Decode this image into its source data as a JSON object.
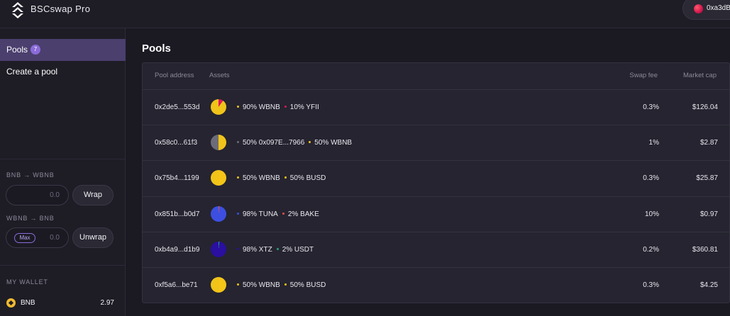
{
  "header": {
    "brand": "BSCswap Pro",
    "account": "0xa3dB",
    "account_color": "#e0194f"
  },
  "sidebar": {
    "nav": [
      {
        "label": "Pools",
        "badge": "7",
        "active": true
      },
      {
        "label": "Create a pool",
        "active": false
      }
    ],
    "wrap": {
      "section_label": "BNB → WBNB",
      "input_value": "0.0",
      "button_label": "Wrap"
    },
    "unwrap": {
      "section_label": "WBNB → BNB",
      "max_label": "Max",
      "input_value": "0.0",
      "button_label": "Unwrap"
    },
    "wallet": {
      "section_label": "MY WALLET",
      "items": [
        {
          "symbol": "BNB",
          "balance": "2.97",
          "icon": "bnb-token-icon",
          "color": "#f3ba2f"
        }
      ]
    }
  },
  "main": {
    "title": "Pools",
    "columns": {
      "address": "Pool address",
      "assets": "Assets",
      "fee": "Swap fee",
      "cap": "Market cap"
    },
    "pools": [
      {
        "address": "0x2de5...553d",
        "assets": [
          {
            "label": "90% WBNB",
            "percent": 90,
            "color": "#f0c419"
          },
          {
            "label": "10% YFII",
            "percent": 10,
            "color": "#e0195a"
          }
        ],
        "fee": "0.3%",
        "cap": "$126.04"
      },
      {
        "address": "0x58c0...61f3",
        "assets": [
          {
            "label": "50% 0x097E...7966",
            "percent": 50,
            "color": "#6c6b78"
          },
          {
            "label": "50% WBNB",
            "percent": 50,
            "color": "#f0c419"
          }
        ],
        "fee": "1%",
        "cap": "$2.87"
      },
      {
        "address": "0x75b4...1199",
        "assets": [
          {
            "label": "50% WBNB",
            "percent": 50,
            "color": "#f0c419"
          },
          {
            "label": "50% BUSD",
            "percent": 50,
            "color": "#f5c518"
          }
        ],
        "fee": "0.3%",
        "cap": "$25.87"
      },
      {
        "address": "0x851b...b0d7",
        "assets": [
          {
            "label": "98% TUNA",
            "percent": 98,
            "color": "#3d4fe0"
          },
          {
            "label": "2% BAKE",
            "percent": 2,
            "color": "#e8504a"
          }
        ],
        "fee": "10%",
        "cap": "$0.97"
      },
      {
        "address": "0xb4a9...d1b9",
        "assets": [
          {
            "label": "98% XTZ",
            "percent": 98,
            "color": "#2a0fa0"
          },
          {
            "label": "2% USDT",
            "percent": 2,
            "color": "#26a17b"
          }
        ],
        "fee": "0.2%",
        "cap": "$360.81"
      },
      {
        "address": "0xf5a6...be71",
        "assets": [
          {
            "label": "50% WBNB",
            "percent": 50,
            "color": "#f0c419"
          },
          {
            "label": "50% BUSD",
            "percent": 50,
            "color": "#f5c518"
          }
        ],
        "fee": "0.3%",
        "cap": "$4.25"
      }
    ]
  }
}
